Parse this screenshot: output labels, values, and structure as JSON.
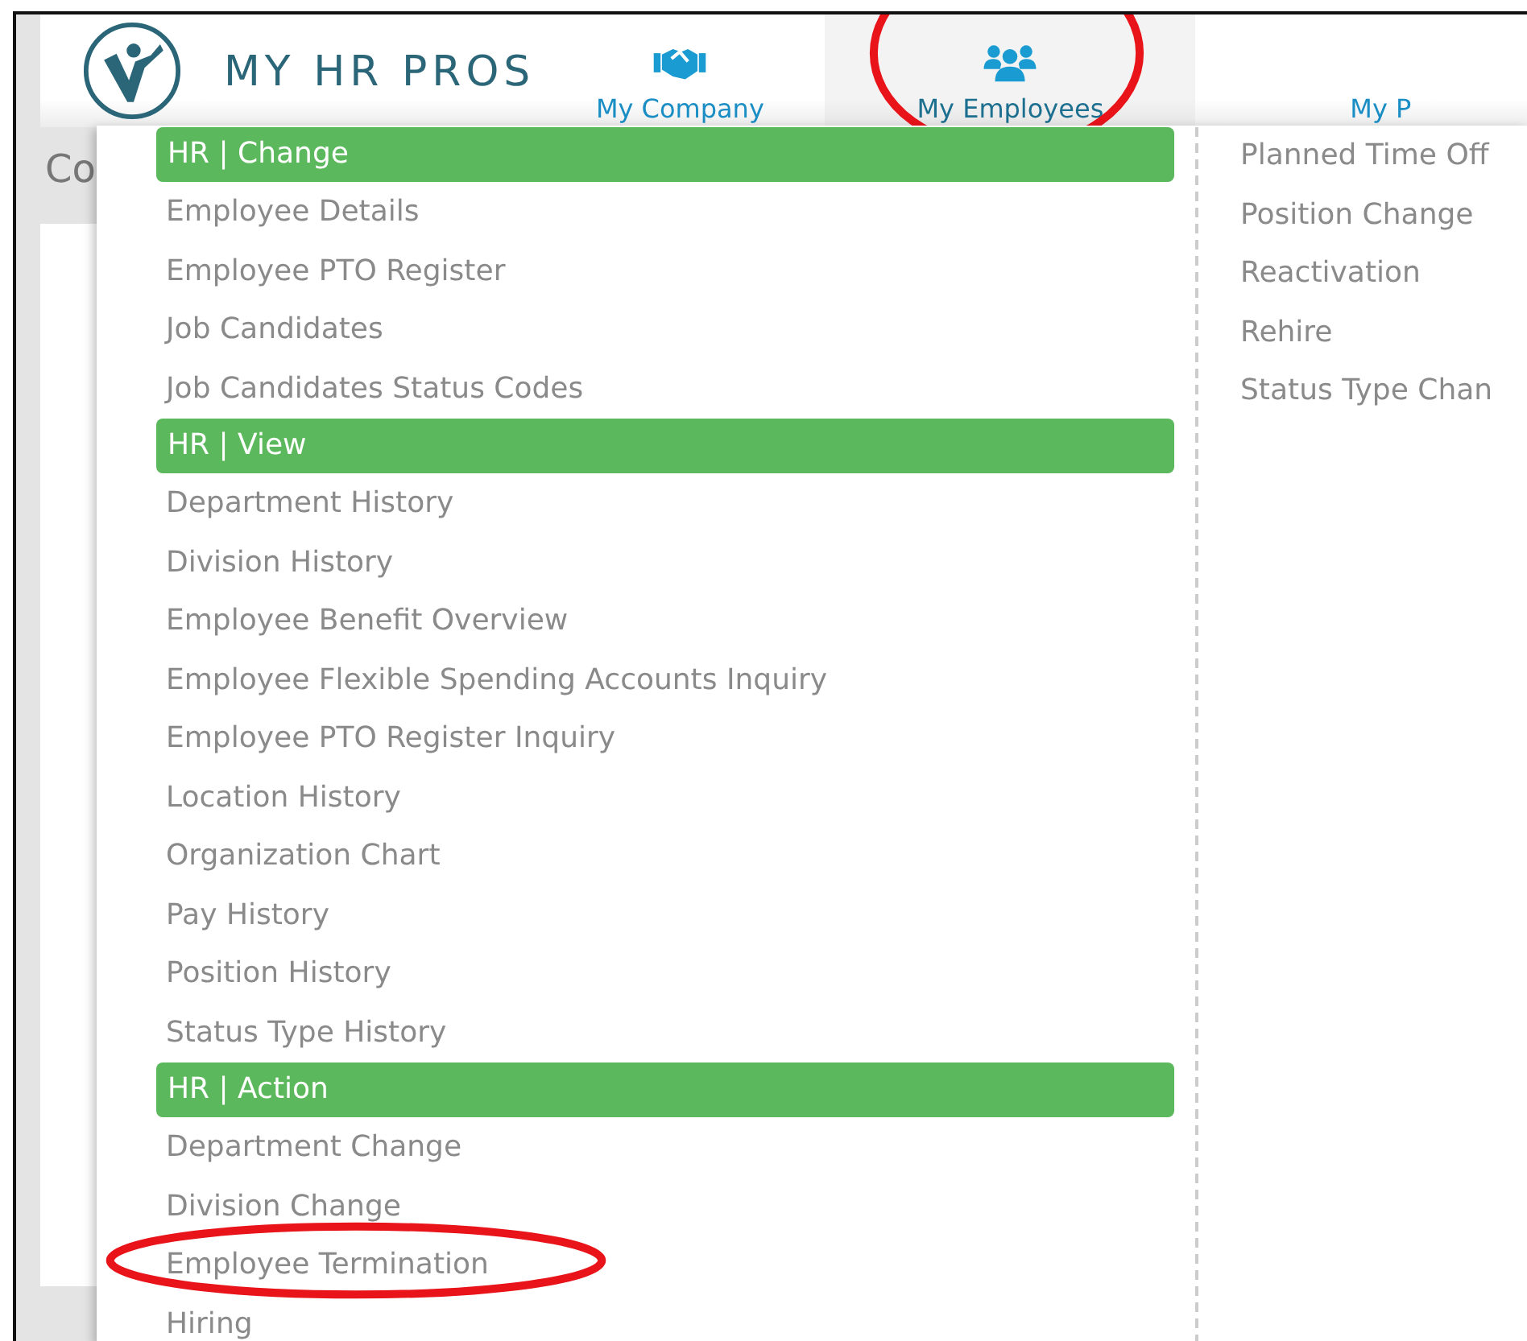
{
  "logo": {
    "text": "MY HR PROS"
  },
  "nav": [
    {
      "label": "My Company",
      "kind": "company",
      "selected": false,
      "circled": false
    },
    {
      "label": "My Employees",
      "kind": "employees",
      "selected": true,
      "circled": true
    },
    {
      "label": "My P",
      "kind": "plain",
      "selected": false,
      "circled": false
    }
  ],
  "background": {
    "heading": "Co"
  },
  "menu": {
    "columns": [
      [
        {
          "kind": "header",
          "label": "HR | Change"
        },
        {
          "kind": "item",
          "label": "Employee Details",
          "circled": false
        },
        {
          "kind": "item",
          "label": "Employee PTO Register",
          "circled": false
        },
        {
          "kind": "item",
          "label": "Job Candidates",
          "circled": false
        },
        {
          "kind": "item",
          "label": "Job Candidates Status Codes",
          "circled": false
        },
        {
          "kind": "header",
          "label": "HR | View"
        },
        {
          "kind": "item",
          "label": "Department History",
          "circled": false
        },
        {
          "kind": "item",
          "label": "Division History",
          "circled": false
        },
        {
          "kind": "item",
          "label": "Employee Benefit Overview",
          "circled": false
        },
        {
          "kind": "item",
          "label": "Employee Flexible Spending Accounts Inquiry",
          "circled": false
        },
        {
          "kind": "item",
          "label": "Employee PTO Register Inquiry",
          "circled": false
        },
        {
          "kind": "item",
          "label": "Location History",
          "circled": false
        },
        {
          "kind": "item",
          "label": "Organization Chart",
          "circled": false
        },
        {
          "kind": "item",
          "label": "Pay History",
          "circled": false
        },
        {
          "kind": "item",
          "label": "Position History",
          "circled": false
        },
        {
          "kind": "item",
          "label": "Status Type History",
          "circled": false
        },
        {
          "kind": "header",
          "label": "HR | Action"
        },
        {
          "kind": "item",
          "label": "Department Change",
          "circled": false
        },
        {
          "kind": "item",
          "label": "Division Change",
          "circled": false
        },
        {
          "kind": "item",
          "label": "Employee Termination",
          "circled": true
        },
        {
          "kind": "item",
          "label": "Hiring",
          "circled": false
        }
      ],
      [
        {
          "kind": "item",
          "label": "Planned Time Off",
          "circled": false
        },
        {
          "kind": "item",
          "label": "Position Change",
          "circled": false
        },
        {
          "kind": "item",
          "label": "Reactivation",
          "circled": false
        },
        {
          "kind": "item",
          "label": "Rehire",
          "circled": false
        },
        {
          "kind": "item",
          "label": "Status Type Chan",
          "circled": false
        }
      ]
    ]
  }
}
